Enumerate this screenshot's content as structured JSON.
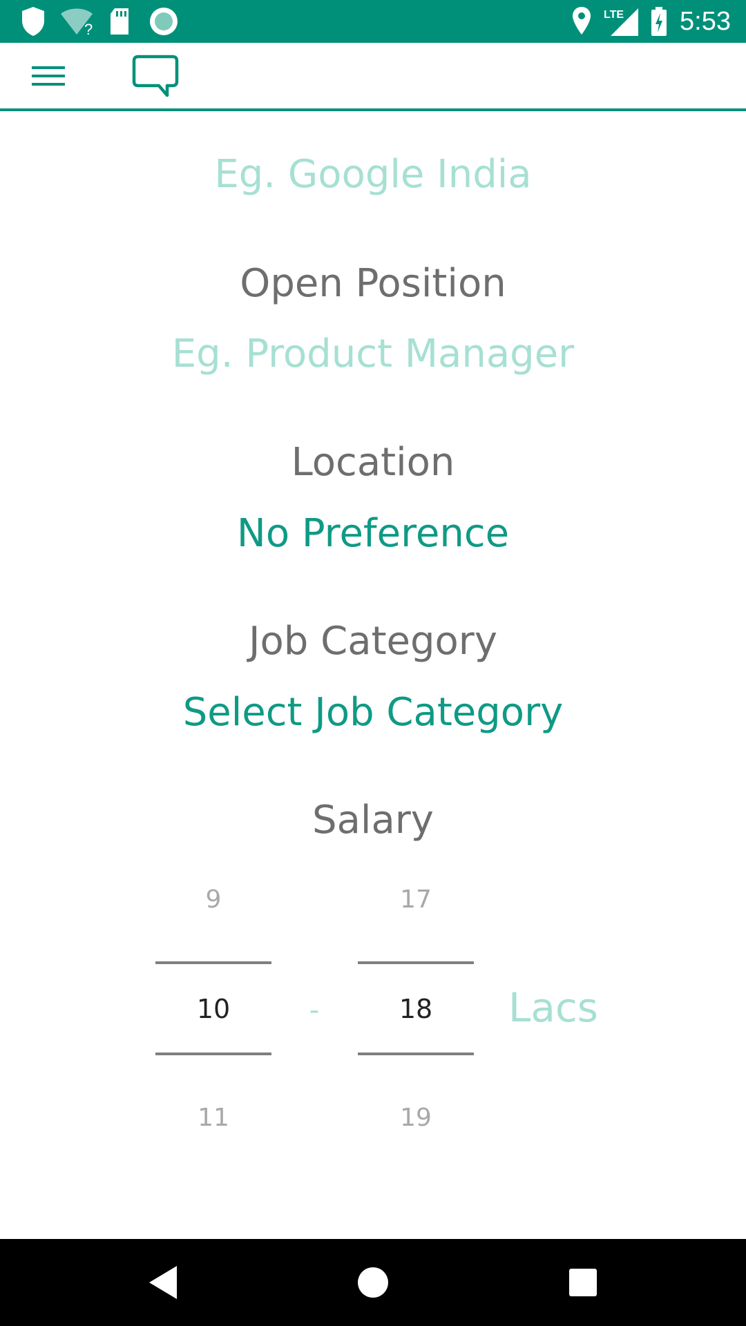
{
  "status_bar": {
    "time": "5:53",
    "icons": [
      "shield-icon",
      "wifi-unknown-icon",
      "sd-card-icon",
      "record-icon",
      "location-icon",
      "lte-signal-icon",
      "battery-charging-icon"
    ],
    "network_label": "LTE",
    "wifi_label": "?"
  },
  "toolbar": {
    "menu_icon": "hamburger-menu-icon",
    "chat_icon": "chat-bubble-icon"
  },
  "form": {
    "company": {
      "placeholder": "Eg. Google India"
    },
    "position": {
      "label": "Open Position",
      "placeholder": "Eg. Product Manager"
    },
    "location": {
      "label": "Location",
      "value": "No Preference"
    },
    "category": {
      "label": "Job Category",
      "value": "Select Job Category"
    },
    "salary": {
      "label": "Salary",
      "min": {
        "above": "9",
        "selected": "10",
        "below": "11"
      },
      "separator": "-",
      "max": {
        "above": "17",
        "selected": "18",
        "below": "19"
      },
      "unit": "Lacs"
    }
  },
  "nav_bar": {
    "icons": [
      "back-icon",
      "home-icon",
      "recents-icon"
    ]
  },
  "colors": {
    "accent": "#00907a",
    "accent_text": "#0f9a85",
    "placeholder": "#a6e0d3",
    "label": "#6e6e6e"
  }
}
